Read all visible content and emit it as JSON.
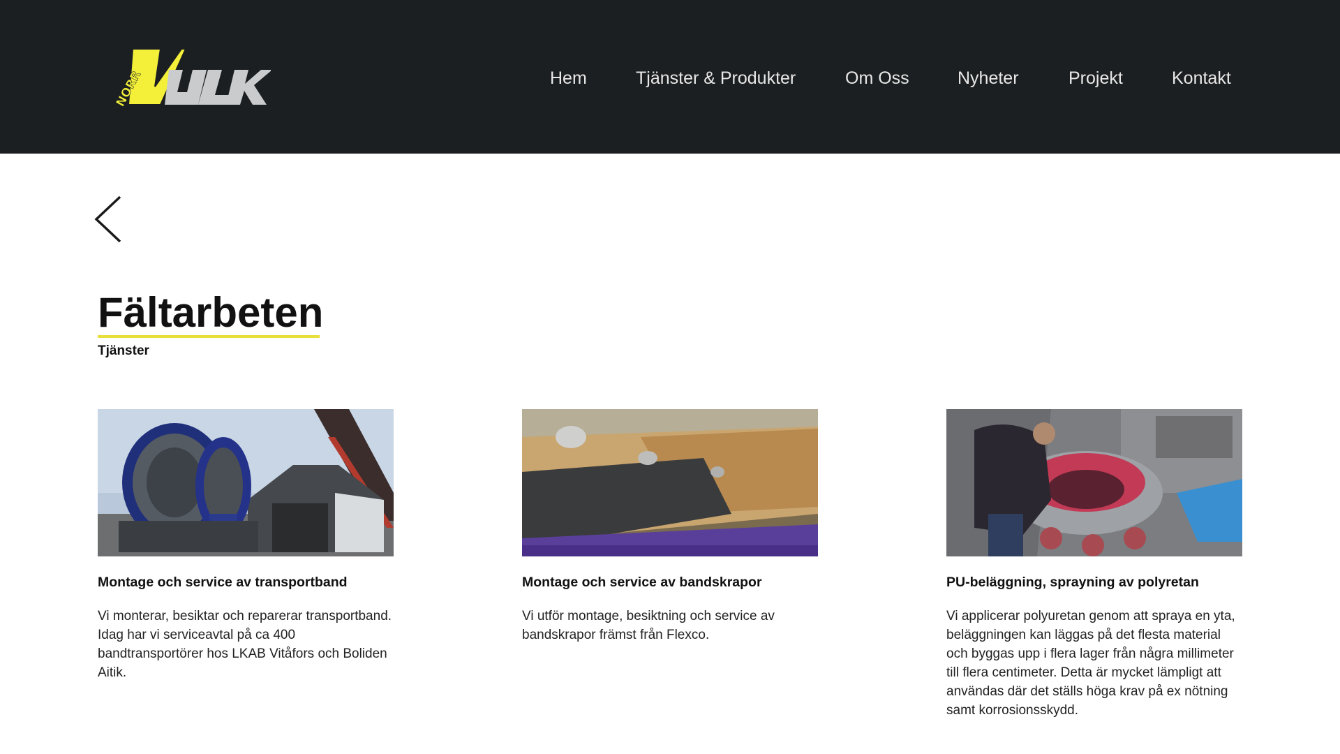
{
  "brand": {
    "logo_small_text": "NORR",
    "logo_main_text": "VULK",
    "logo_colors": {
      "yellow": "#f4f03a",
      "gray": "#c9cbcd",
      "black": "#1c1f21"
    }
  },
  "nav": {
    "items": [
      {
        "label": "Hem"
      },
      {
        "label": "Tjänster & Produkter"
      },
      {
        "label": "Om Oss"
      },
      {
        "label": "Nyheter"
      },
      {
        "label": "Projekt"
      },
      {
        "label": "Kontakt"
      }
    ]
  },
  "back": {
    "icon": "chevron-left-icon"
  },
  "page": {
    "title": "Fältarbeten",
    "subtitle": "Tjänster",
    "accent_color": "#e9df3a"
  },
  "cards": [
    {
      "image": "conveyor-belt-reels-photo",
      "title": "Montage och service av transportband",
      "text": "Vi monterar, besiktar och reparerar transportband. Idag har vi serviceavtal på ca 400 bandtransportörer hos LKAB Vitåfors och Boliden Aitik."
    },
    {
      "image": "belt-scraper-photo",
      "title": "Montage och service av bandskrapor",
      "text": "Vi utför montage, besiktning och service av bandskrapor främst från Flexco."
    },
    {
      "image": "polyurethan-spraying-photo",
      "title": "PU-beläggning, sprayning av polyretan",
      "text": "Vi applicerar polyuretan genom att spraya en yta, beläggningen kan läggas på det flesta material och byggas upp i flera lager från några millimeter till flera centimeter. Detta är mycket lämpligt att användas där det ställs höga krav på ex nötning samt korrosionsskydd."
    }
  ]
}
